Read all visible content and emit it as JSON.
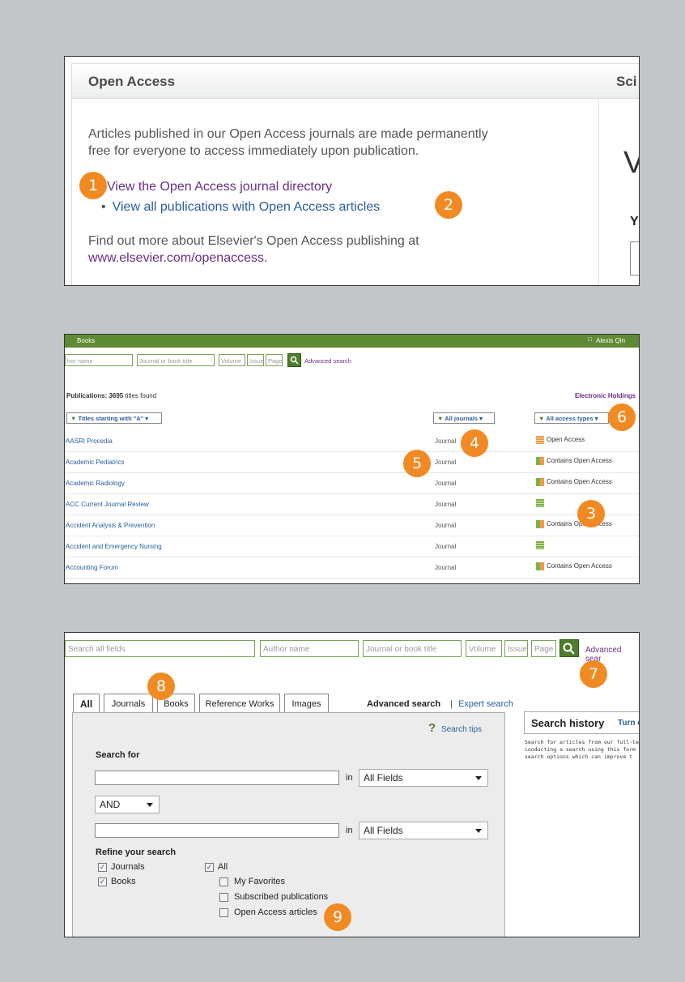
{
  "badges": [
    "1",
    "2",
    "3",
    "4",
    "5",
    "6",
    "7",
    "8",
    "9"
  ],
  "panel1": {
    "header_title": "Open Access",
    "header_right": "Sci",
    "intro_line1": "Articles published in our Open Access journals are made permanently",
    "intro_line2": "free for everyone to access immediately upon publication.",
    "link1": "View the Open Access journal directory",
    "link2": "View all publications with Open Access articles",
    "bullet": "•",
    "more_line1": "Find out more about Elsevier's Open Access publishing at",
    "more_link": "www.elsevier.com/openaccess.",
    "right_big": "V",
    "right_bold": "Y"
  },
  "panel2": {
    "topbar_label": "Books",
    "user_name": "Alexis Qin",
    "inputs": [
      "hor name",
      "Journal or book title",
      "Volume",
      "Issue",
      "Page"
    ],
    "advanced_search": "Advanced search",
    "count_label": "Publications: 3695",
    "count_suffix": "titles found",
    "holdings": "Electronic Holdings",
    "filter_titles": "Titles starting with \"A\" ▾",
    "filter_journals": "All journals ▾",
    "filter_access": "All access types ▾",
    "rows": [
      {
        "name": "AASRI Procedia",
        "type": "Journal",
        "access": "Open Access",
        "icon": "open"
      },
      {
        "name": "Academic Pediatrics",
        "type": "Journal",
        "access": "Contains Open Access",
        "icon": "contains"
      },
      {
        "name": "Academic Radiology",
        "type": "Journal",
        "access": "Contains Open Access",
        "icon": "contains"
      },
      {
        "name": "ACC Current Journal Review",
        "type": "Journal",
        "access": "",
        "icon": "green"
      },
      {
        "name": "Accident Analysis & Prevention",
        "type": "Journal",
        "access": "Contains Open Access",
        "icon": "contains"
      },
      {
        "name": "Accident and Emergency Nursing",
        "type": "Journal",
        "access": "",
        "icon": "green"
      },
      {
        "name": "Accounting Forum",
        "type": "Journal",
        "access": "Contains Open Access",
        "icon": "contains"
      }
    ]
  },
  "panel3": {
    "search_all": "Search all fields",
    "author": "Author name",
    "journal": "Journal or book title",
    "volume": "Volume",
    "issue": "Issue",
    "page": "Page",
    "advanced_link": "Advanced sear",
    "tabs": [
      "All",
      "Journals",
      "Books",
      "Reference Works",
      "Images"
    ],
    "advanced_search": "Advanced search",
    "separator": "|",
    "expert_search": "Expert search",
    "search_tips": "Search tips",
    "search_for": "Search for",
    "in_label": "in",
    "field1": "All Fields",
    "operator": "AND",
    "field2": "All Fields",
    "refine": "Refine your search",
    "checks": {
      "journals": "Journals",
      "books": "Books",
      "all": "All",
      "favorites": "My Favorites",
      "subscribed": "Subscribed publications",
      "open_access": "Open Access articles"
    },
    "history_title": "Search history",
    "history_toggle": "Turn o",
    "history_text1": "Search for articles from our full-tex",
    "history_text2": "conducting a search using this form",
    "history_text3": "search options which can improve t"
  }
}
